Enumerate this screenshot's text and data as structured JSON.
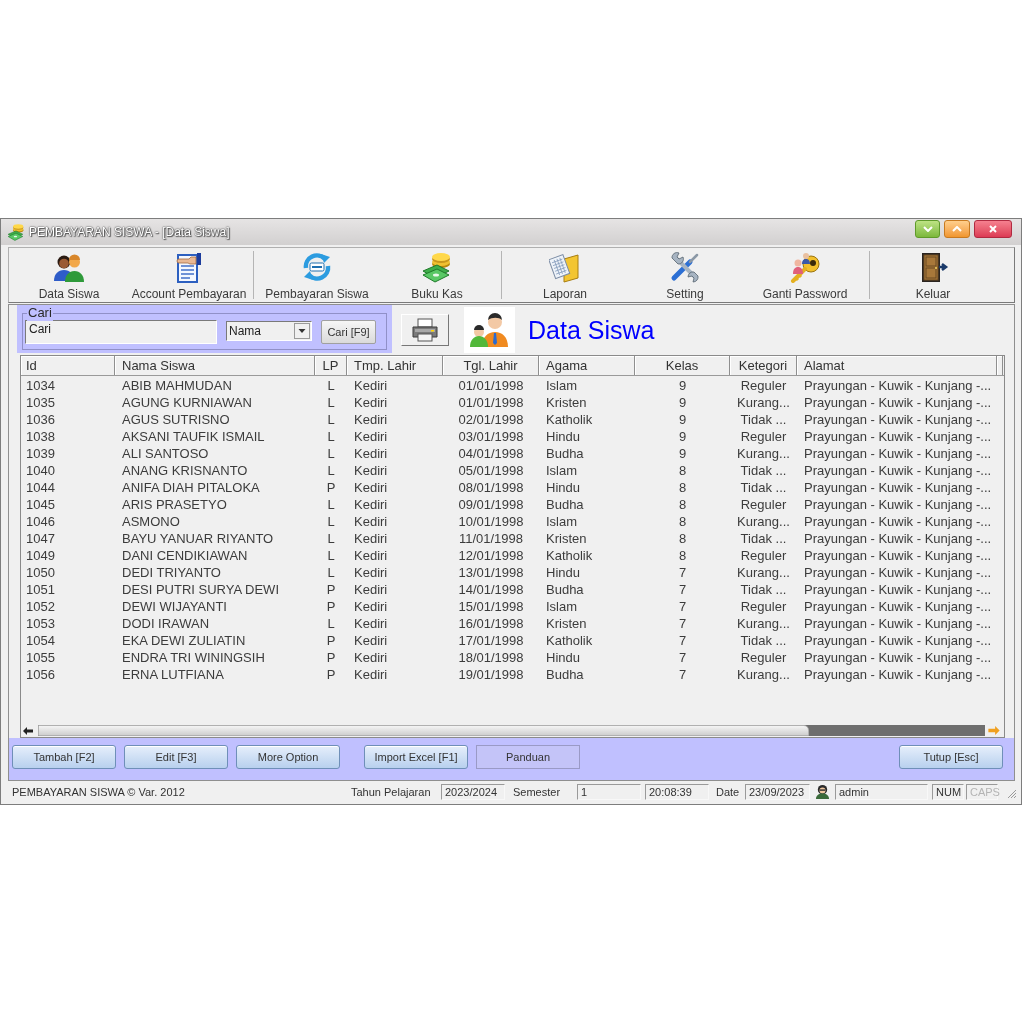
{
  "window": {
    "title": "PEMBAYARAN SISWA - [Data Siswa]"
  },
  "toolbar": {
    "groups": [
      [
        {
          "label": "Data Siswa"
        },
        {
          "label": "Account Pembayaran"
        }
      ],
      [
        {
          "label": "Pembayaran Siswa"
        },
        {
          "label": "Buku Kas"
        }
      ],
      [
        {
          "label": "Laporan"
        },
        {
          "label": "Setting"
        },
        {
          "label": "Ganti Password"
        }
      ],
      [
        {
          "label": "Keluar"
        }
      ]
    ]
  },
  "search": {
    "legend": "Cari",
    "value": "Cari",
    "filter": "Nama",
    "button": "Cari [F9]"
  },
  "page_title": "Data Siswa",
  "table": {
    "columns": [
      "Id",
      "Nama Siswa",
      "LP",
      "Tmp. Lahir",
      "Tgl. Lahir",
      "Agama",
      "Kelas",
      "Ketegori",
      "Alamat"
    ],
    "rows": [
      [
        "1034",
        "ABIB MAHMUDAN",
        "L",
        "Kediri",
        "01/01/1998",
        "Islam",
        "9",
        "Reguler",
        "Prayungan - Kuwik - Kunjang -..."
      ],
      [
        "1035",
        "AGUNG KURNIAWAN",
        "L",
        "Kediri",
        "01/01/1998",
        "Kristen",
        "9",
        "Kurang...",
        "Prayungan - Kuwik - Kunjang -..."
      ],
      [
        "1036",
        "AGUS SUTRISNO",
        "L",
        "Kediri",
        "02/01/1998",
        "Katholik",
        "9",
        "Tidak ...",
        "Prayungan - Kuwik - Kunjang -..."
      ],
      [
        "1038",
        "AKSANI TAUFIK ISMAIL",
        "L",
        "Kediri",
        "03/01/1998",
        "Hindu",
        "9",
        "Reguler",
        "Prayungan - Kuwik - Kunjang -..."
      ],
      [
        "1039",
        "ALI SANTOSO",
        "L",
        "Kediri",
        "04/01/1998",
        "Budha",
        "9",
        "Kurang...",
        "Prayungan - Kuwik - Kunjang -..."
      ],
      [
        "1040",
        "ANANG KRISNANTO",
        "L",
        "Kediri",
        "05/01/1998",
        "Islam",
        "8",
        "Tidak ...",
        "Prayungan - Kuwik - Kunjang -..."
      ],
      [
        "1044",
        "ANIFA DIAH PITALOKA",
        "P",
        "Kediri",
        "08/01/1998",
        "Hindu",
        "8",
        "Tidak ...",
        "Prayungan - Kuwik - Kunjang -..."
      ],
      [
        "1045",
        "ARIS PRASETYO",
        "L",
        "Kediri",
        "09/01/1998",
        "Budha",
        "8",
        "Reguler",
        "Prayungan - Kuwik - Kunjang -..."
      ],
      [
        "1046",
        "ASMONO",
        "L",
        "Kediri",
        "10/01/1998",
        "Islam",
        "8",
        "Kurang...",
        "Prayungan - Kuwik - Kunjang -..."
      ],
      [
        "1047",
        "BAYU YANUAR RIYANTO",
        "L",
        "Kediri",
        "11/01/1998",
        "Kristen",
        "8",
        "Tidak ...",
        "Prayungan - Kuwik - Kunjang -..."
      ],
      [
        "1049",
        "DANI CENDIKIAWAN",
        "L",
        "Kediri",
        "12/01/1998",
        "Katholik",
        "8",
        "Reguler",
        "Prayungan - Kuwik - Kunjang -..."
      ],
      [
        "1050",
        "DEDI TRIYANTO",
        "L",
        "Kediri",
        "13/01/1998",
        "Hindu",
        "7",
        "Kurang...",
        "Prayungan - Kuwik - Kunjang -..."
      ],
      [
        "1051",
        "DESI PUTRI SURYA DEWI",
        "P",
        "Kediri",
        "14/01/1998",
        "Budha",
        "7",
        "Tidak ...",
        "Prayungan - Kuwik - Kunjang -..."
      ],
      [
        "1052",
        "DEWI WIJAYANTI",
        "P",
        "Kediri",
        "15/01/1998",
        "Islam",
        "7",
        "Reguler",
        "Prayungan - Kuwik - Kunjang -..."
      ],
      [
        "1053",
        "DODI IRAWAN",
        "L",
        "Kediri",
        "16/01/1998",
        "Kristen",
        "7",
        "Kurang...",
        "Prayungan - Kuwik - Kunjang -..."
      ],
      [
        "1054",
        "EKA DEWI ZULIATIN",
        "P",
        "Kediri",
        "17/01/1998",
        "Katholik",
        "7",
        "Tidak ...",
        "Prayungan - Kuwik - Kunjang -..."
      ],
      [
        "1055",
        "ENDRA TRI WININGSIH",
        "P",
        "Kediri",
        "18/01/1998",
        "Hindu",
        "7",
        "Reguler",
        "Prayungan - Kuwik - Kunjang -..."
      ],
      [
        "1056",
        "ERNA LUTFIANA",
        "P",
        "Kediri",
        "19/01/1998",
        "Budha",
        "7",
        "Kurang...",
        "Prayungan - Kuwik - Kunjang -..."
      ]
    ]
  },
  "button_bar": {
    "groups": [
      [
        {
          "label": "Tambah [F2]",
          "kind": "raised"
        },
        {
          "label": "Edit [F3]",
          "kind": "raised"
        },
        {
          "label": "More Option",
          "kind": "raised"
        }
      ],
      [
        {
          "label": "Import Excel [F1]",
          "kind": "raised"
        },
        {
          "label": "Panduan",
          "kind": "flat"
        }
      ],
      [
        {
          "label": "Tutup [Esc]",
          "kind": "raised"
        }
      ]
    ]
  },
  "status_bar": {
    "app": "PEMBAYARAN SISWA © Var. 2012",
    "year": {
      "label": "Tahun Pelajaran",
      "value": "2023/2024"
    },
    "semester": {
      "label": "Semester",
      "value": "1"
    },
    "time": "20:08:39",
    "date": {
      "label": "Date",
      "value": "23/09/2023"
    },
    "user": "admin",
    "keys": [
      {
        "label": "NUM",
        "on": true
      },
      {
        "label": "CAPS",
        "on": false
      }
    ]
  }
}
